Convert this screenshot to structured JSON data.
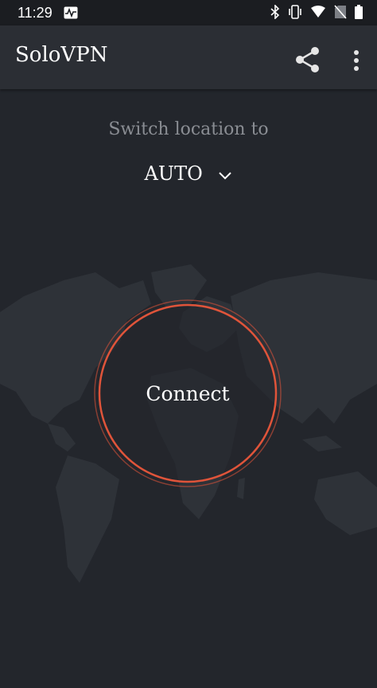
{
  "status_bar": {
    "time": "11:29",
    "icons": [
      "activity-icon",
      "bluetooth-icon",
      "vibrate-icon",
      "wifi-icon",
      "no-sim-icon",
      "battery-icon"
    ]
  },
  "app_bar": {
    "title": "SoloVPN",
    "actions": [
      "share-icon",
      "more-vert-icon"
    ]
  },
  "main": {
    "switch_label": "Switch location to",
    "location": "AUTO",
    "connect_label": "Connect"
  },
  "colors": {
    "background": "#23262c",
    "app_bar": "#2b2e34",
    "ring": "#e0543a",
    "muted_text": "#8a8d93"
  }
}
